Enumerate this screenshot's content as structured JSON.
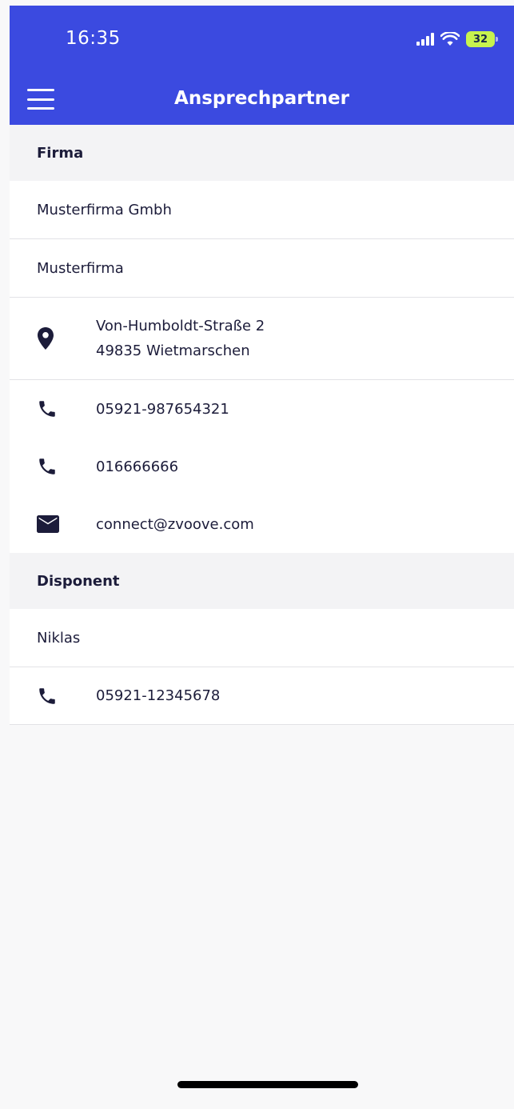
{
  "status_bar": {
    "time": "16:35",
    "battery": "32"
  },
  "app_bar": {
    "title": "Ansprechpartner",
    "menu_icon": "hamburger-menu-icon"
  },
  "firma": {
    "header": "Firma",
    "name": "Musterfirma Gmbh",
    "short_name": "Musterfirma",
    "address_line1": "Von-Humboldt-Straße 2",
    "address_line2": "49835 Wietmarschen",
    "phone1": "05921-987654321",
    "phone2": "016666666",
    "email": "connect@zvoove.com"
  },
  "disponent": {
    "header": "Disponent",
    "name": "Niklas",
    "phone": "05921-12345678"
  },
  "icons": {
    "location": "location-pin-icon",
    "phone": "phone-icon",
    "email": "email-icon"
  },
  "colors": {
    "app_bar": "#3b4ae0",
    "icon": "#1c1c3a",
    "battery": "#c7f34e"
  }
}
